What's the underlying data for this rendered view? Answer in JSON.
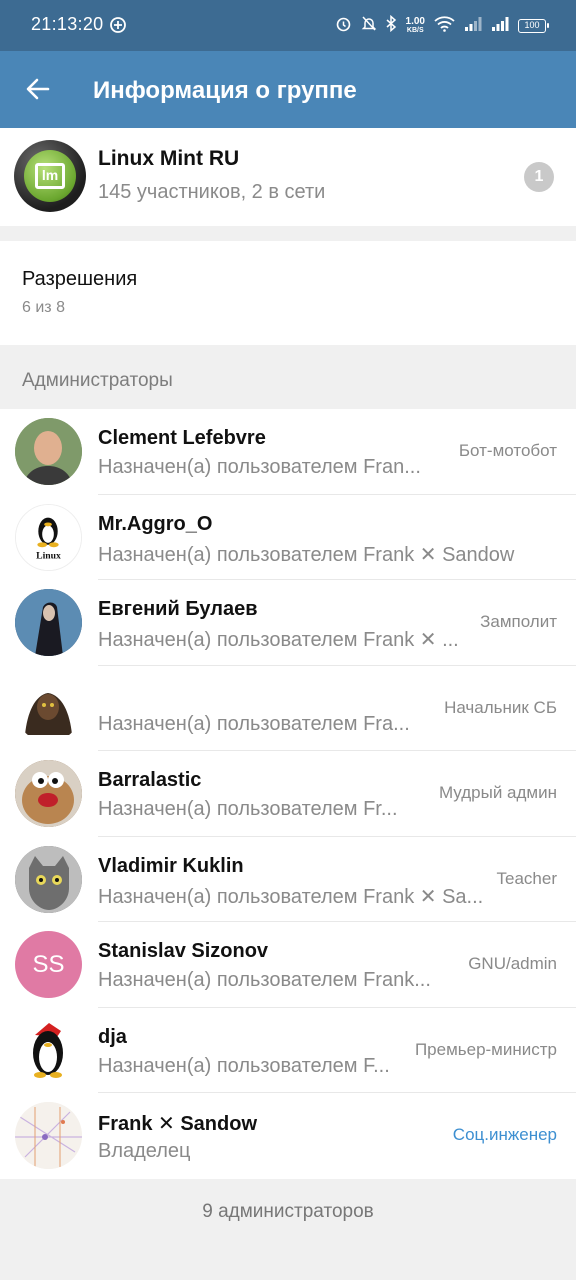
{
  "status_bar": {
    "time": "21:13:20",
    "net_speed_value": "1.00",
    "net_speed_unit": "KB/S",
    "battery": "100"
  },
  "app_bar": {
    "title": "Информация о группе"
  },
  "group": {
    "name": "Linux Mint RU",
    "subtitle": "145 участников, 2 в сети",
    "badge_count": "1"
  },
  "permissions": {
    "title": "Разрешения",
    "value": "6 из 8"
  },
  "admins_section": {
    "header": "Администраторы",
    "items": [
      {
        "name": "Clement Lefebvre",
        "subtitle": "Назначен(а) пользователем Fran...",
        "role": "Бот-мотобот",
        "avatar": "photo"
      },
      {
        "name": "Mr.Aggro_O",
        "subtitle": "Назначен(а) пользователем Frank ✕ Sandow",
        "role": "",
        "avatar": "linux-tux"
      },
      {
        "name": "Евгений Булаев",
        "subtitle": "Назначен(а) пользователем Frank ✕ ...",
        "role": "Замполит",
        "avatar": "photo"
      },
      {
        "name": "",
        "subtitle": "Назначен(а) пользователем Fra...",
        "role": "Начальник СБ",
        "avatar": "photo"
      },
      {
        "name": "Barralastic",
        "subtitle": "Назначен(а) пользователем Fr...",
        "role": "Мудрый админ",
        "avatar": "photo"
      },
      {
        "name": "Vladimir Kuklin",
        "subtitle": "Назначен(а) пользователем Frank ✕ Sa...",
        "role": "Teacher",
        "avatar": "photo"
      },
      {
        "name": "Stanislav Sizonov",
        "subtitle": "Назначен(а) пользователем Frank...",
        "role": "GNU/admin",
        "avatar": "SS",
        "avatar_color": "#e07aa4"
      },
      {
        "name": "dja",
        "subtitle": "Назначен(а) пользователем F...",
        "role": "Премьер-министр",
        "avatar": "penguin"
      },
      {
        "name": "Frank ✕ Sandow",
        "subtitle": "Владелец",
        "role": "Соц.инженер",
        "avatar": "photo",
        "role_color": "#3d8fd1"
      }
    ]
  },
  "footer": {
    "admins_count": "9 администраторов"
  },
  "colors": {
    "status_bar": "#3d6b92",
    "app_bar": "#4a86b7",
    "accent": "#3d8fd1"
  }
}
